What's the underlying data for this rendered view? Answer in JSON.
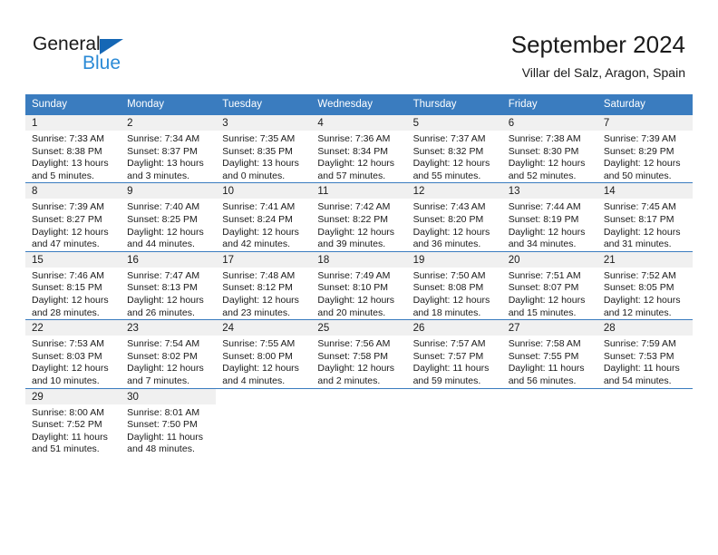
{
  "logo": {
    "word_one": "General",
    "word_two": "Blue",
    "triangle_color": "#1567b5",
    "blue_color": "#2b8ad6"
  },
  "header": {
    "title": "September 2024",
    "subtitle": "Villar del Salz, Aragon, Spain"
  },
  "theme": {
    "header_blue": "#3a7cbf",
    "daynum_bg": "#f0f0f0",
    "text": "#1a1a1a"
  },
  "calendar": {
    "weekday_headers": [
      "Sunday",
      "Monday",
      "Tuesday",
      "Wednesday",
      "Thursday",
      "Friday",
      "Saturday"
    ],
    "weeks": [
      [
        {
          "day": "1",
          "sunrise": "Sunrise: 7:33 AM",
          "sunset": "Sunset: 8:38 PM",
          "daylight": "Daylight: 13 hours and 5 minutes."
        },
        {
          "day": "2",
          "sunrise": "Sunrise: 7:34 AM",
          "sunset": "Sunset: 8:37 PM",
          "daylight": "Daylight: 13 hours and 3 minutes."
        },
        {
          "day": "3",
          "sunrise": "Sunrise: 7:35 AM",
          "sunset": "Sunset: 8:35 PM",
          "daylight": "Daylight: 13 hours and 0 minutes."
        },
        {
          "day": "4",
          "sunrise": "Sunrise: 7:36 AM",
          "sunset": "Sunset: 8:34 PM",
          "daylight": "Daylight: 12 hours and 57 minutes."
        },
        {
          "day": "5",
          "sunrise": "Sunrise: 7:37 AM",
          "sunset": "Sunset: 8:32 PM",
          "daylight": "Daylight: 12 hours and 55 minutes."
        },
        {
          "day": "6",
          "sunrise": "Sunrise: 7:38 AM",
          "sunset": "Sunset: 8:30 PM",
          "daylight": "Daylight: 12 hours and 52 minutes."
        },
        {
          "day": "7",
          "sunrise": "Sunrise: 7:39 AM",
          "sunset": "Sunset: 8:29 PM",
          "daylight": "Daylight: 12 hours and 50 minutes."
        }
      ],
      [
        {
          "day": "8",
          "sunrise": "Sunrise: 7:39 AM",
          "sunset": "Sunset: 8:27 PM",
          "daylight": "Daylight: 12 hours and 47 minutes."
        },
        {
          "day": "9",
          "sunrise": "Sunrise: 7:40 AM",
          "sunset": "Sunset: 8:25 PM",
          "daylight": "Daylight: 12 hours and 44 minutes."
        },
        {
          "day": "10",
          "sunrise": "Sunrise: 7:41 AM",
          "sunset": "Sunset: 8:24 PM",
          "daylight": "Daylight: 12 hours and 42 minutes."
        },
        {
          "day": "11",
          "sunrise": "Sunrise: 7:42 AM",
          "sunset": "Sunset: 8:22 PM",
          "daylight": "Daylight: 12 hours and 39 minutes."
        },
        {
          "day": "12",
          "sunrise": "Sunrise: 7:43 AM",
          "sunset": "Sunset: 8:20 PM",
          "daylight": "Daylight: 12 hours and 36 minutes."
        },
        {
          "day": "13",
          "sunrise": "Sunrise: 7:44 AM",
          "sunset": "Sunset: 8:19 PM",
          "daylight": "Daylight: 12 hours and 34 minutes."
        },
        {
          "day": "14",
          "sunrise": "Sunrise: 7:45 AM",
          "sunset": "Sunset: 8:17 PM",
          "daylight": "Daylight: 12 hours and 31 minutes."
        }
      ],
      [
        {
          "day": "15",
          "sunrise": "Sunrise: 7:46 AM",
          "sunset": "Sunset: 8:15 PM",
          "daylight": "Daylight: 12 hours and 28 minutes."
        },
        {
          "day": "16",
          "sunrise": "Sunrise: 7:47 AM",
          "sunset": "Sunset: 8:13 PM",
          "daylight": "Daylight: 12 hours and 26 minutes."
        },
        {
          "day": "17",
          "sunrise": "Sunrise: 7:48 AM",
          "sunset": "Sunset: 8:12 PM",
          "daylight": "Daylight: 12 hours and 23 minutes."
        },
        {
          "day": "18",
          "sunrise": "Sunrise: 7:49 AM",
          "sunset": "Sunset: 8:10 PM",
          "daylight": "Daylight: 12 hours and 20 minutes."
        },
        {
          "day": "19",
          "sunrise": "Sunrise: 7:50 AM",
          "sunset": "Sunset: 8:08 PM",
          "daylight": "Daylight: 12 hours and 18 minutes."
        },
        {
          "day": "20",
          "sunrise": "Sunrise: 7:51 AM",
          "sunset": "Sunset: 8:07 PM",
          "daylight": "Daylight: 12 hours and 15 minutes."
        },
        {
          "day": "21",
          "sunrise": "Sunrise: 7:52 AM",
          "sunset": "Sunset: 8:05 PM",
          "daylight": "Daylight: 12 hours and 12 minutes."
        }
      ],
      [
        {
          "day": "22",
          "sunrise": "Sunrise: 7:53 AM",
          "sunset": "Sunset: 8:03 PM",
          "daylight": "Daylight: 12 hours and 10 minutes."
        },
        {
          "day": "23",
          "sunrise": "Sunrise: 7:54 AM",
          "sunset": "Sunset: 8:02 PM",
          "daylight": "Daylight: 12 hours and 7 minutes."
        },
        {
          "day": "24",
          "sunrise": "Sunrise: 7:55 AM",
          "sunset": "Sunset: 8:00 PM",
          "daylight": "Daylight: 12 hours and 4 minutes."
        },
        {
          "day": "25",
          "sunrise": "Sunrise: 7:56 AM",
          "sunset": "Sunset: 7:58 PM",
          "daylight": "Daylight: 12 hours and 2 minutes."
        },
        {
          "day": "26",
          "sunrise": "Sunrise: 7:57 AM",
          "sunset": "Sunset: 7:57 PM",
          "daylight": "Daylight: 11 hours and 59 minutes."
        },
        {
          "day": "27",
          "sunrise": "Sunrise: 7:58 AM",
          "sunset": "Sunset: 7:55 PM",
          "daylight": "Daylight: 11 hours and 56 minutes."
        },
        {
          "day": "28",
          "sunrise": "Sunrise: 7:59 AM",
          "sunset": "Sunset: 7:53 PM",
          "daylight": "Daylight: 11 hours and 54 minutes."
        }
      ],
      [
        {
          "day": "29",
          "sunrise": "Sunrise: 8:00 AM",
          "sunset": "Sunset: 7:52 PM",
          "daylight": "Daylight: 11 hours and 51 minutes."
        },
        {
          "day": "30",
          "sunrise": "Sunrise: 8:01 AM",
          "sunset": "Sunset: 7:50 PM",
          "daylight": "Daylight: 11 hours and 48 minutes."
        },
        {
          "day": "",
          "sunrise": "",
          "sunset": "",
          "daylight": ""
        },
        {
          "day": "",
          "sunrise": "",
          "sunset": "",
          "daylight": ""
        },
        {
          "day": "",
          "sunrise": "",
          "sunset": "",
          "daylight": ""
        },
        {
          "day": "",
          "sunrise": "",
          "sunset": "",
          "daylight": ""
        },
        {
          "day": "",
          "sunrise": "",
          "sunset": "",
          "daylight": ""
        }
      ]
    ]
  }
}
